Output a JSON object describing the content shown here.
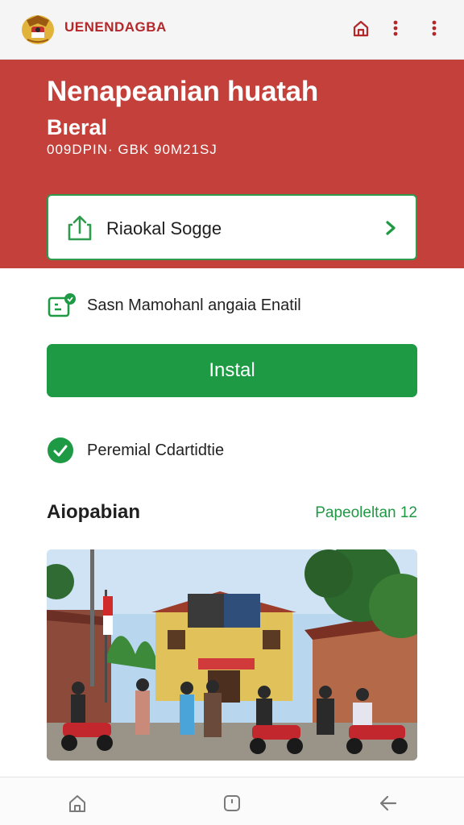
{
  "header": {
    "app_name": "UENENDAGBA",
    "icons": [
      "emblem-logo",
      "home-icon",
      "more-vertical-icon",
      "more-vertical-icon"
    ]
  },
  "hero": {
    "title": "Nenapeanian huatah",
    "subtitle": "Bıeral",
    "code": "009DPIN· GBK 90M21SJ"
  },
  "upload_card": {
    "label": "Riaokal Sogge",
    "icon": "upload-icon"
  },
  "notice": {
    "text": "Sasn Mamohanl angaia Enatil",
    "icon": "calendar-badge-icon"
  },
  "install_button": {
    "label": "Instal"
  },
  "status": {
    "text": "Peremial  Cdartidtie",
    "icon": "check-circle-icon"
  },
  "section": {
    "title": "Aiopabian",
    "link": "Papeoleltan 12"
  },
  "bottom_nav": {
    "icons": [
      "home-icon",
      "recents-icon",
      "back-icon"
    ]
  },
  "colors": {
    "brand_red": "#c3403b",
    "accent_green": "#1e9a44",
    "header_text_red": "#b4272b"
  }
}
